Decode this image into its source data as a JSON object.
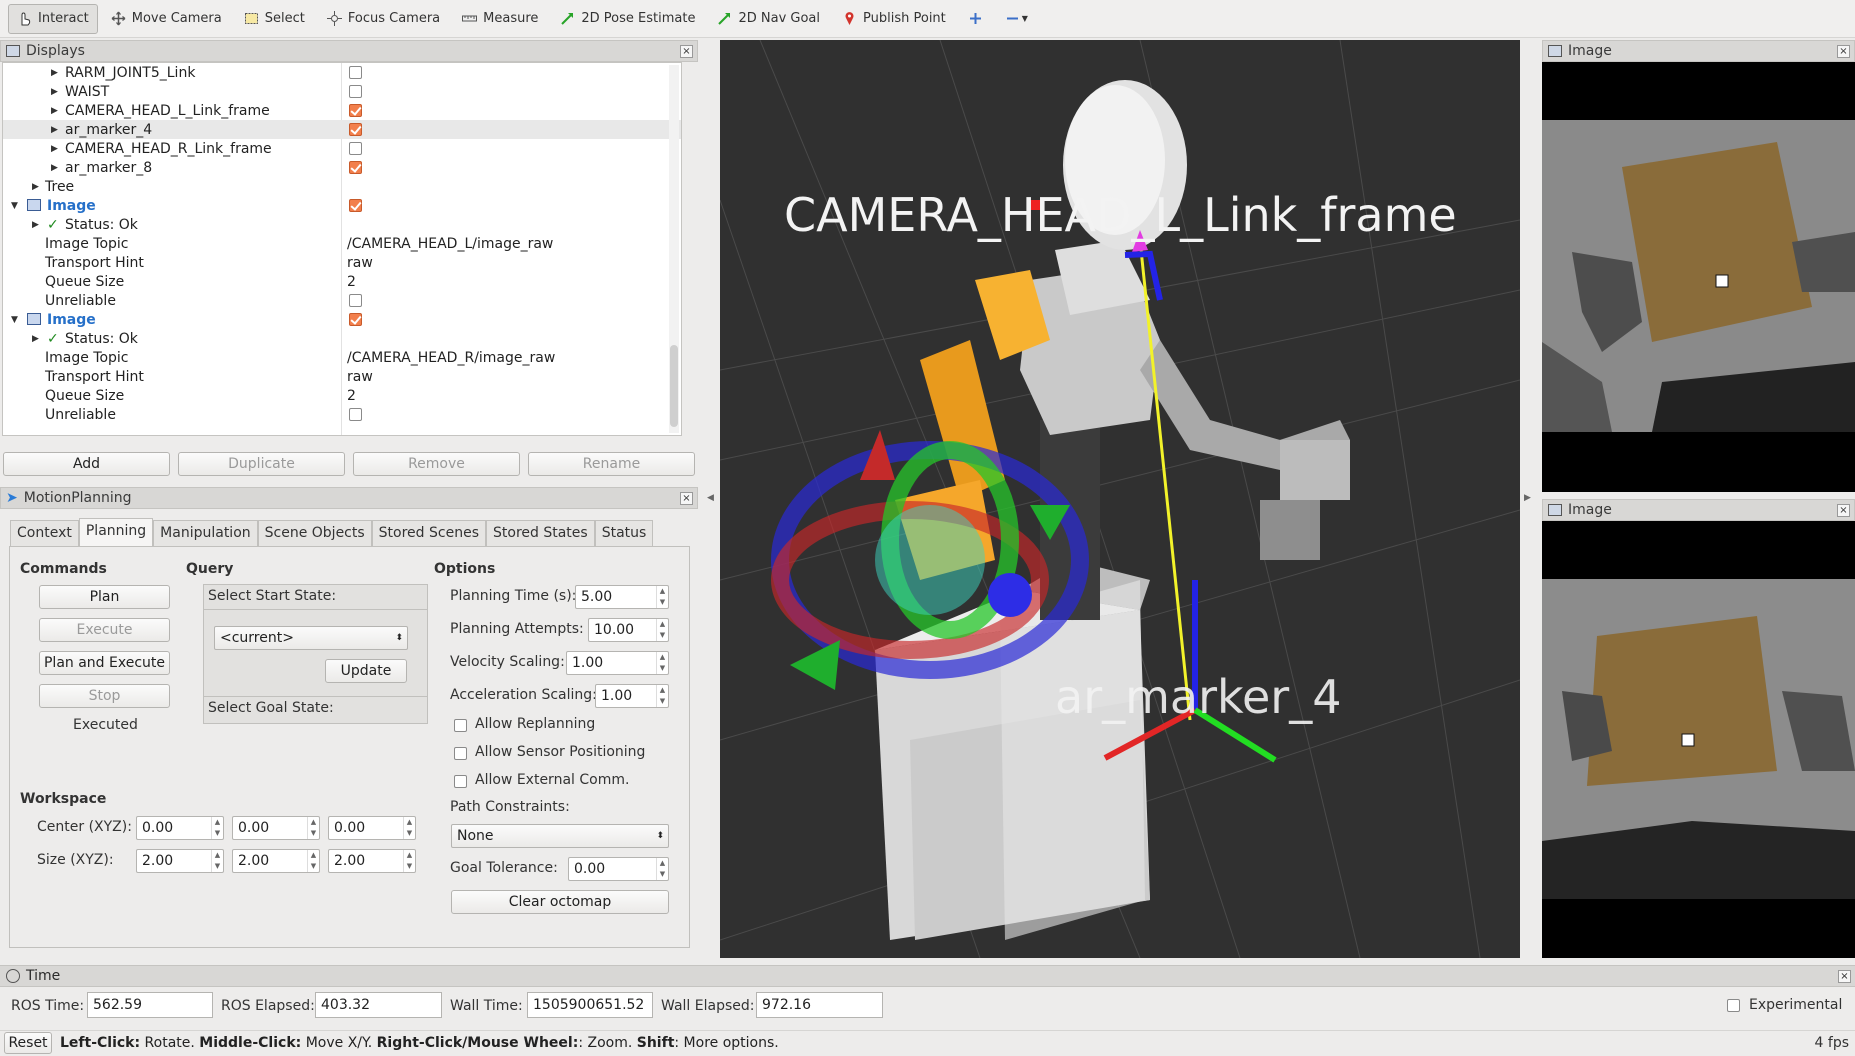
{
  "toolbar": {
    "tools": [
      {
        "label": "Interact",
        "icon": "cursor-hand-icon",
        "active": true
      },
      {
        "label": "Move Camera",
        "icon": "move-camera-icon"
      },
      {
        "label": "Select",
        "icon": "select-box-icon"
      },
      {
        "label": "Focus Camera",
        "icon": "focus-camera-icon"
      },
      {
        "label": "Measure",
        "icon": "ruler-icon"
      },
      {
        "label": "2D Pose Estimate",
        "icon": "pose-estimate-arrow-icon"
      },
      {
        "label": "2D Nav Goal",
        "icon": "nav-goal-arrow-icon"
      },
      {
        "label": "Publish Point",
        "icon": "map-pin-icon"
      }
    ]
  },
  "displays": {
    "title": "Displays",
    "rows": [
      {
        "name": "RARM_JOINT5_Link",
        "checked": false
      },
      {
        "name": "WAIST",
        "checked": false
      },
      {
        "name": "CAMERA_HEAD_L_Link_frame",
        "checked": true
      },
      {
        "name": "ar_marker_4",
        "checked": true,
        "selected": true
      },
      {
        "name": "CAMERA_HEAD_R_Link_frame",
        "checked": false
      },
      {
        "name": "ar_marker_8",
        "checked": true
      },
      {
        "name": "Tree"
      },
      {
        "name": "Image",
        "checked": true
      },
      {
        "name": "Status: Ok"
      },
      {
        "name": "Image Topic",
        "value": "/CAMERA_HEAD_L/image_raw"
      },
      {
        "name": "Transport Hint",
        "value": "raw"
      },
      {
        "name": "Queue Size",
        "value": "2"
      },
      {
        "name": "Unreliable",
        "checked": false
      },
      {
        "name": "Image",
        "checked": true
      },
      {
        "name": "Status: Ok"
      },
      {
        "name": "Image Topic",
        "value": "/CAMERA_HEAD_R/image_raw"
      },
      {
        "name": "Transport Hint",
        "value": "raw"
      },
      {
        "name": "Queue Size",
        "value": "2"
      },
      {
        "name": "Unreliable",
        "checked": false
      }
    ],
    "buttons": {
      "add": "Add",
      "duplicate": "Duplicate",
      "remove": "Remove",
      "rename": "Rename"
    }
  },
  "motion_planning": {
    "title": "MotionPlanning",
    "tabs": [
      "Context",
      "Planning",
      "Manipulation",
      "Scene Objects",
      "Stored Scenes",
      "Stored States",
      "Status"
    ],
    "commands": {
      "heading": "Commands",
      "plan": "Plan",
      "execute": "Execute",
      "plan_and_execute": "Plan and Execute",
      "stop": "Stop",
      "status": "Executed"
    },
    "query": {
      "heading": "Query",
      "start_state_label": "Select Start State:",
      "start_state_value": "<current>",
      "update": "Update",
      "goal_state_label": "Select Goal State:"
    },
    "options": {
      "heading": "Options",
      "planning_time_label": "Planning Time (s):",
      "planning_time": "5.00",
      "planning_attempts_label": "Planning Attempts:",
      "planning_attempts": "10.00",
      "velocity_scaling_label": "Velocity Scaling:",
      "velocity_scaling": "1.00",
      "acceleration_scaling_label": "Acceleration Scaling:",
      "acceleration_scaling": "1.00",
      "allow_replanning": "Allow Replanning",
      "allow_sensor_positioning": "Allow Sensor Positioning",
      "allow_external_comm": "Allow External Comm.",
      "path_constraints_label": "Path Constraints:",
      "path_constraints_value": "None",
      "goal_tolerance_label": "Goal Tolerance:",
      "goal_tolerance": "0.00",
      "clear_octomap": "Clear octomap"
    },
    "workspace": {
      "heading": "Workspace",
      "center_label": "Center (XYZ):",
      "center": [
        "0.00",
        "0.00",
        "0.00"
      ],
      "size_label": "Size (XYZ):",
      "size": [
        "2.00",
        "2.00",
        "2.00"
      ]
    }
  },
  "viewport": {
    "label_camera": "CAMERA_HEAD_L_Link_frame",
    "label_marker": "ar_marker_4"
  },
  "image_panels": [
    {
      "title": "Image"
    },
    {
      "title": "Image"
    }
  ],
  "time": {
    "title": "Time",
    "ros_time_label": "ROS Time:",
    "ros_time": "562.59",
    "ros_elapsed_label": "ROS Elapsed:",
    "ros_elapsed": "403.32",
    "wall_time_label": "Wall Time:",
    "wall_time": "1505900651.52",
    "wall_elapsed_label": "Wall Elapsed:",
    "wall_elapsed": "972.16",
    "experimental": "Experimental"
  },
  "status_bar": {
    "reset": "Reset",
    "left_click_key": "Left-Click:",
    "left_click_val": " Rotate. ",
    "middle_click_key": "Middle-Click:",
    "middle_click_val": " Move X/Y. ",
    "right_click_key": "Right-Click/Mouse Wheel:",
    "right_click_val": ": Zoom. ",
    "shift_key": "Shift",
    "shift_val": ": More options.",
    "fps": "4 fps"
  },
  "colors": {
    "check_orange": "#f27f4c",
    "tree_blue": "#2670c9",
    "viewport_bg": "#303030"
  }
}
